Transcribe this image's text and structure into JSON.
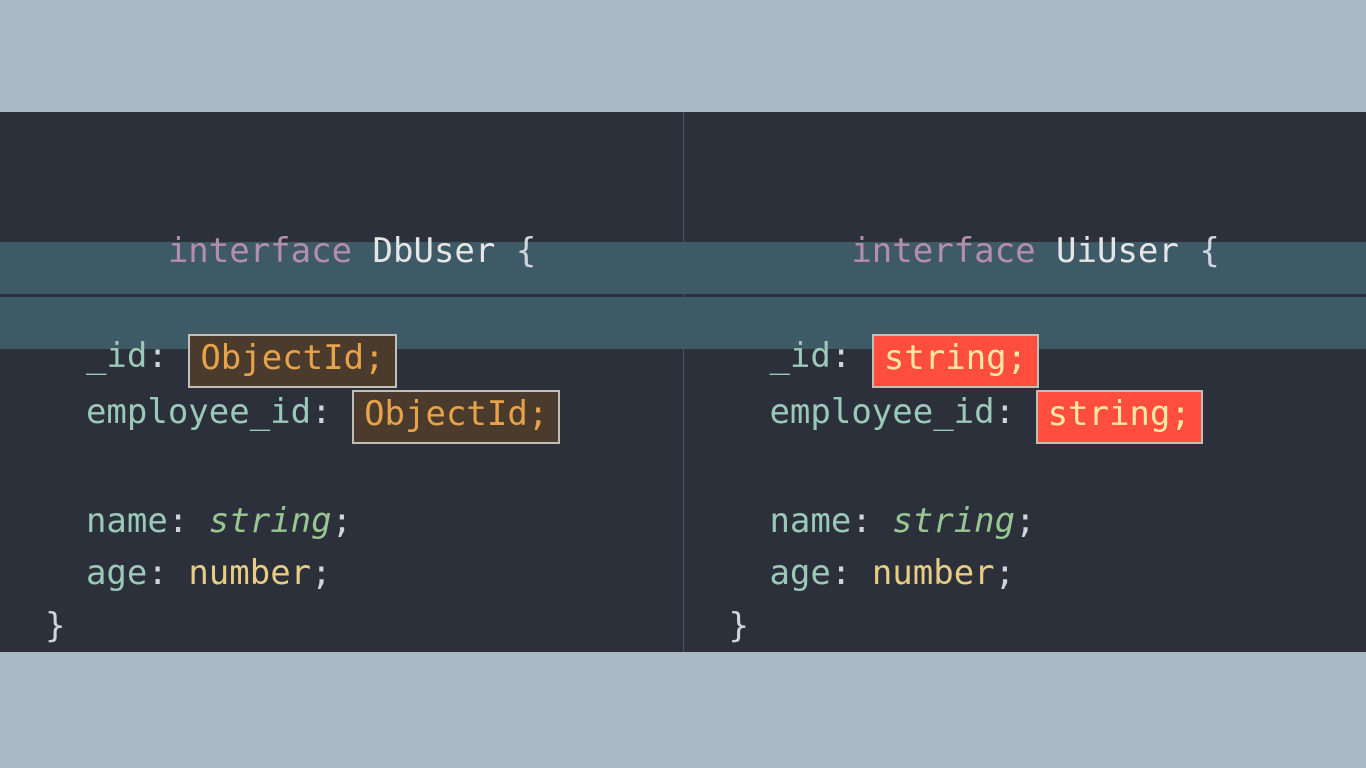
{
  "keyword": "interface",
  "open_brace": "{",
  "close_brace": "}",
  "left": {
    "name": "DbUser",
    "lines": [
      {
        "prop": "_id",
        "type": "ObjectId;",
        "hl": "db"
      },
      {
        "prop": "employee_id",
        "type": "ObjectId;",
        "hl": "db"
      },
      {
        "blank": true
      },
      {
        "prop": "name",
        "type_kind": "string",
        "type": "string",
        "semi": ";"
      },
      {
        "prop": "age",
        "type_kind": "number",
        "type": "number",
        "semi": ";"
      }
    ]
  },
  "right": {
    "name": "UiUser",
    "lines": [
      {
        "prop": "_id",
        "type": "string;",
        "hl": "ui"
      },
      {
        "prop": "employee_id",
        "type": "string;",
        "hl": "ui"
      },
      {
        "blank": true
      },
      {
        "prop": "name",
        "type_kind": "string",
        "type": "string",
        "semi": ";"
      },
      {
        "prop": "age",
        "type_kind": "number",
        "type": "number",
        "semi": ";"
      }
    ]
  }
}
